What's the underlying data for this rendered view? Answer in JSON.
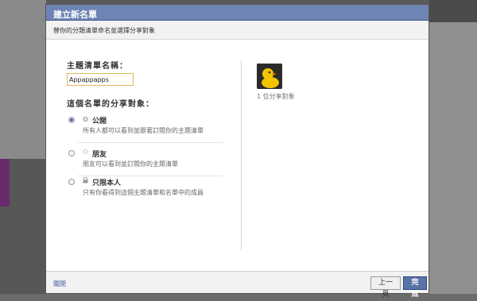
{
  "dialog": {
    "title": "建立新名單",
    "subtitle": "替你的分類清單命名並選擇分享對象"
  },
  "form": {
    "name_label": "主題清單名稱：",
    "name_value": "Appappapps",
    "share_label": "這個名單的分享對象："
  },
  "options": [
    {
      "icon": "globe-icon",
      "title": "公開",
      "description": "所有人都可以看到並跟著訂閱你的主題清單",
      "selected": true
    },
    {
      "icon": "friends-icon",
      "title": "朋友",
      "description": "朋友可以看到並訂閱你的主題清單",
      "selected": false
    },
    {
      "icon": "lock-icon",
      "title": "只限本人",
      "description": "只有你看得到這個主題清單和名單中的成員",
      "selected": false
    }
  ],
  "shared_with": {
    "count_text": "1 位分享對象",
    "avatar_icon": "duck-avatar-icon"
  },
  "footer": {
    "close_label": "關閉",
    "prev_label": "上一頁",
    "done_label": "完成"
  },
  "colors": {
    "titlebar": "#6d84b4",
    "primary_button": "#5b74a8",
    "input_focus_border": "#e0b85a"
  }
}
